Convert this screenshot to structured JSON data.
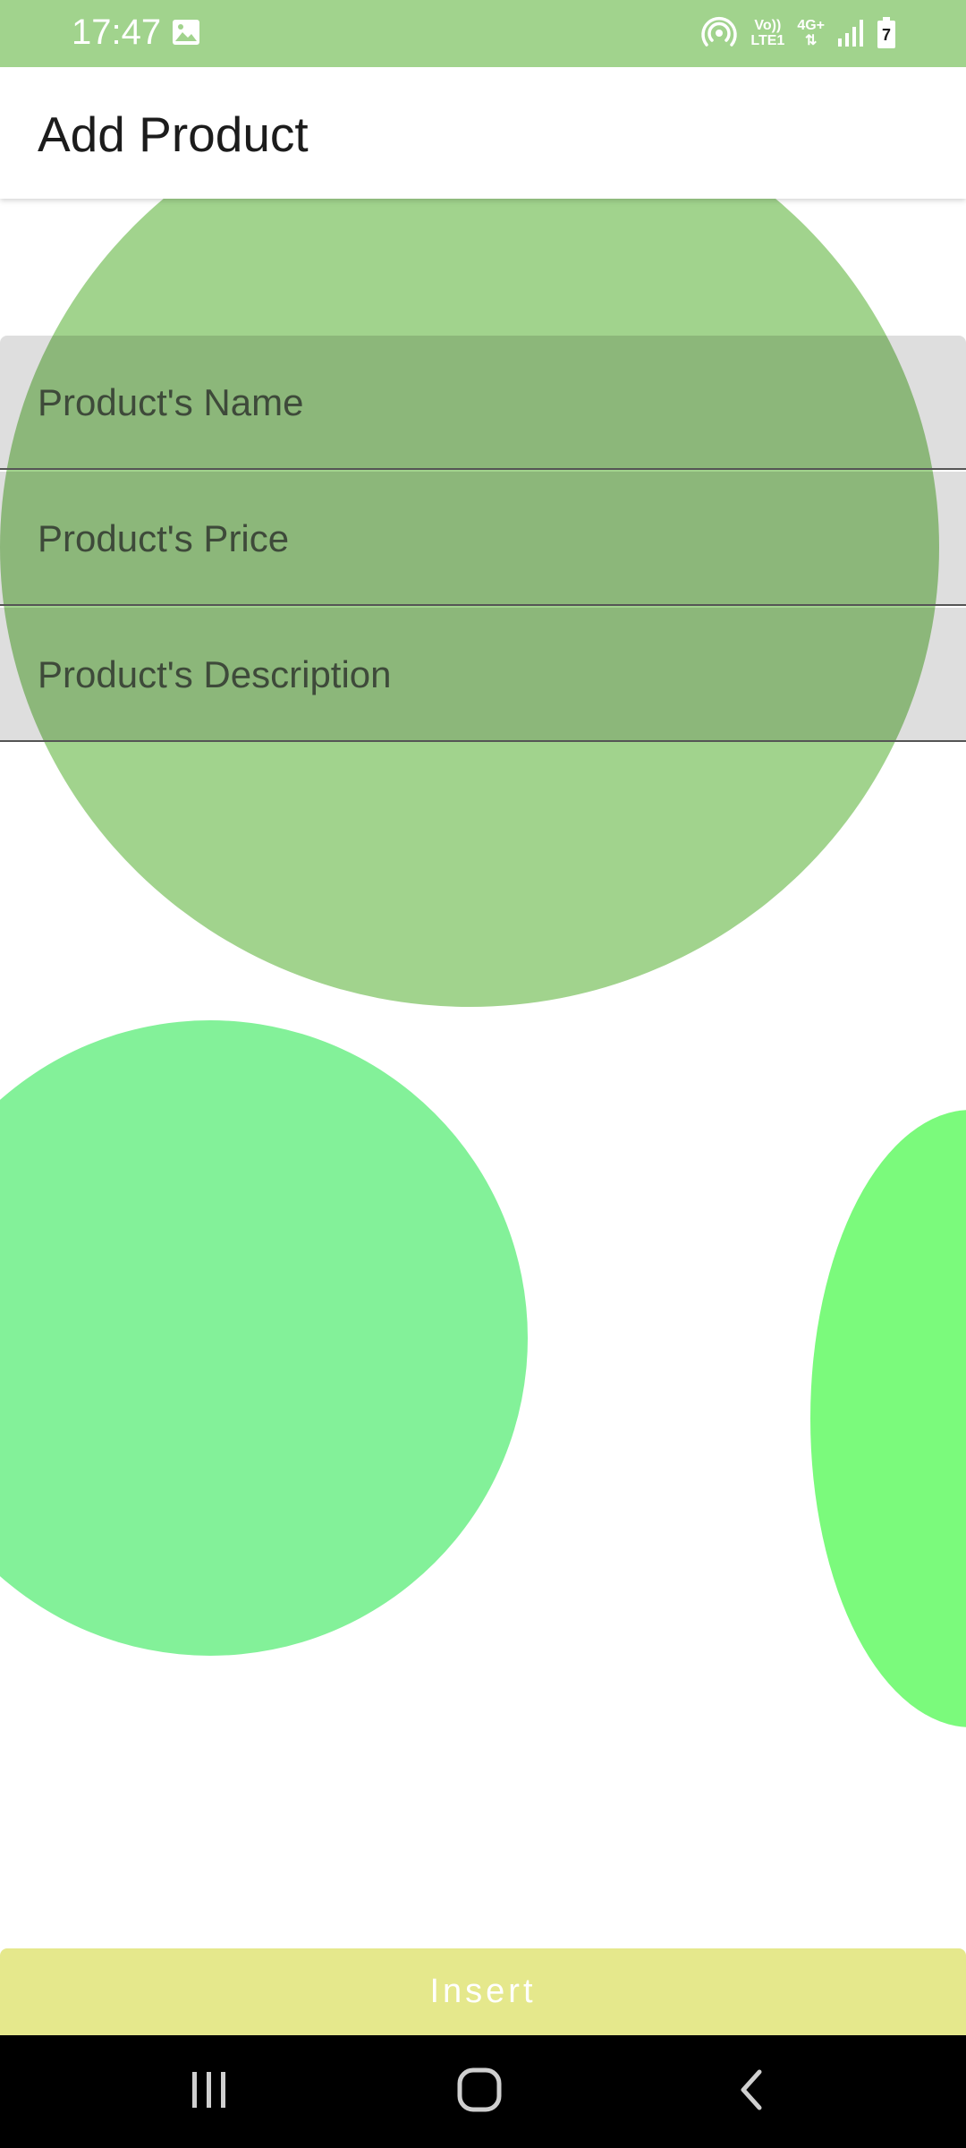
{
  "status_bar": {
    "time": "17:47",
    "network_volte": "Vo))",
    "network_lte": "LTE1",
    "network_type": "4G+",
    "battery_level": "7",
    "background_color": "#a1d38d"
  },
  "app_bar": {
    "title": "Add Product"
  },
  "form": {
    "name_placeholder": "Product's Name",
    "price_placeholder": "Product's Price",
    "description_placeholder": "Product's Description"
  },
  "insert_button": {
    "label": "Insert",
    "color": "#e5e88c"
  },
  "decor": {
    "circle_large_color": "#a1d38d",
    "circle_left_color": "#83f199",
    "circle_right_color": "#7bfa7c"
  },
  "icons": {
    "status_gallery": "image-icon",
    "status_hotspot": "hotspot-icon",
    "status_signal": "signal-icon",
    "status_battery": "battery-icon",
    "nav_recent": "recent-apps-icon",
    "nav_home": "home-icon",
    "nav_back": "back-icon"
  }
}
